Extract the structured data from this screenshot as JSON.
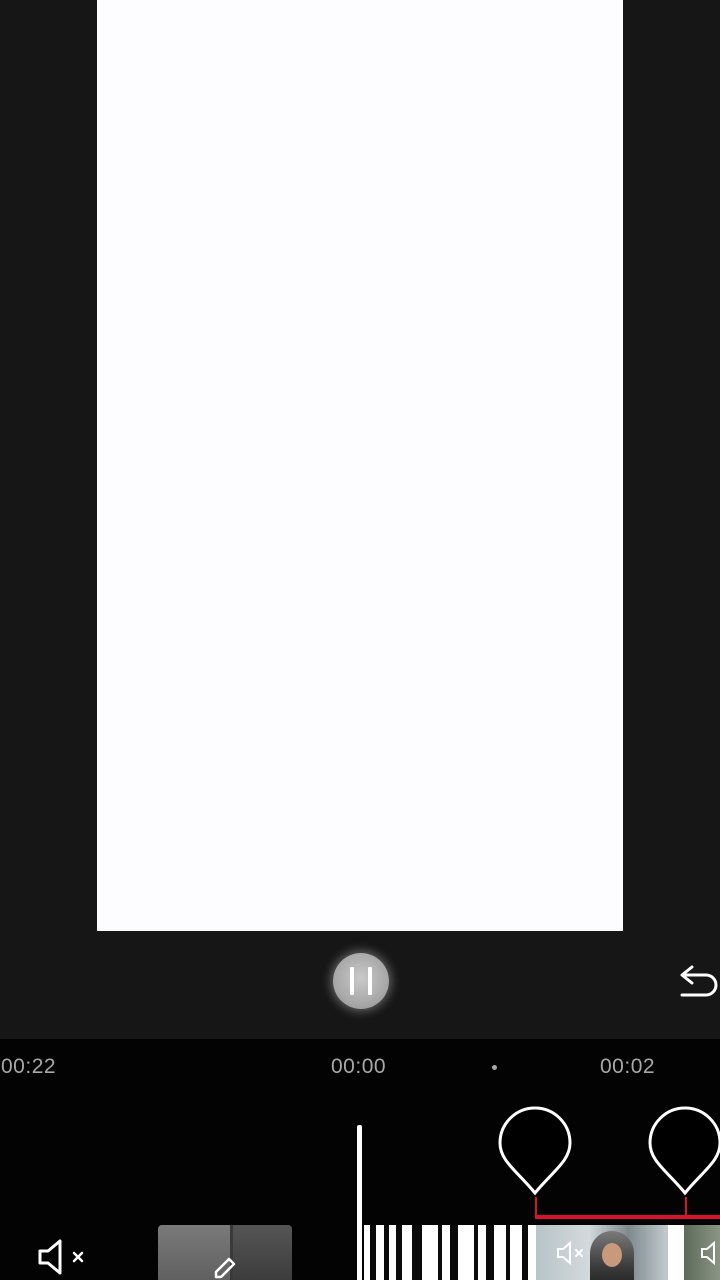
{
  "player": {
    "pause_icon": "pause-icon",
    "undo_icon": "undo-icon"
  },
  "timeline": {
    "time_left": "00:22",
    "time_current": "00:00",
    "time_right": "00:02",
    "keyframe_color": "#d8142d",
    "mute_icon": "speaker-muted-icon",
    "cover_edit_icon": "pencil-icon"
  }
}
